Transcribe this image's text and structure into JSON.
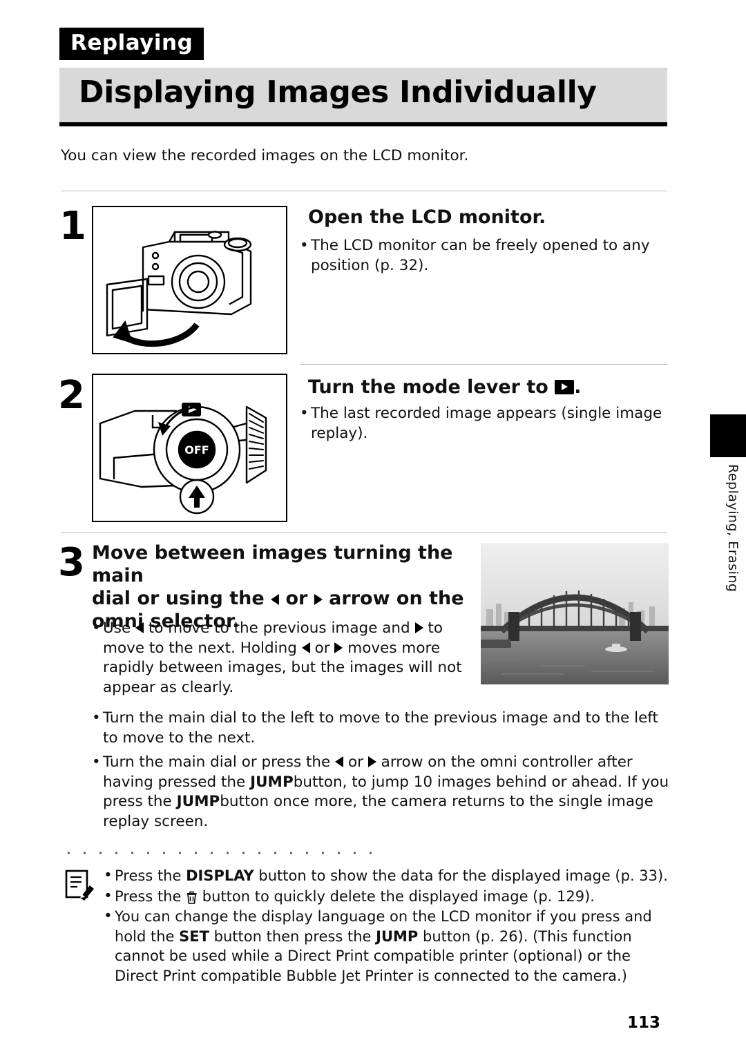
{
  "header": {
    "section_tag": "Replaying",
    "title": "Displaying Images Individually"
  },
  "intro": "You can view the recorded images on the LCD monitor.",
  "steps": [
    {
      "number": "1",
      "heading": "Open the LCD monitor.",
      "bullets": [
        "The LCD monitor can be freely opened to any position (p. 32)."
      ],
      "illustration": "camera-lcd-monitor-open-diagram"
    },
    {
      "number": "2",
      "heading_prefix": "Turn the mode lever to",
      "heading_suffix": ".",
      "heading_icon": "replay-mode-icon",
      "bullets": [
        "The last recorded image appears (single image replay)."
      ],
      "illustration": "camera-mode-dial-diagram"
    },
    {
      "number": "3",
      "heading_part1": "Move between images turning the main",
      "heading_part2_a": "dial or using the",
      "heading_part2_b": "or",
      "heading_part2_c": "arrow on the",
      "heading_part3": "omni selector.",
      "bullets": [
        {
          "a": "Use",
          "b": "to move to the previous image and",
          "c": "to move to the next. Holding",
          "d": "or",
          "e": "moves more rapidly between images, but the images will not appear as clearly."
        },
        {
          "text": "Turn the main dial to the left to move to the previous image and to the left to move to the next."
        },
        {
          "a": "Turn the main dial or press the",
          "b": "or",
          "c": "arrow on the omni controller after having pressed the",
          "jump1": "JUMP",
          "d": "button, to jump 10 images behind or ahead. If you press the",
          "jump2": "JUMP",
          "e": "button once more, the camera returns to the single image replay screen."
        }
      ],
      "photo_caption": "sydney-harbour-bridge-sample-photo"
    }
  ],
  "notes": [
    {
      "a": "Press the",
      "kbd": "DISPLAY",
      "b": "button to show the data for the displayed image (p. 33)."
    },
    {
      "a": "Press the",
      "icon": "trash-icon",
      "b": "button to quickly delete the displayed image (p. 129)."
    },
    {
      "a": "You can change the display language on the LCD monitor if you press and hold the",
      "kbd1": "SET",
      "b": "button then press the",
      "kbd2": "JUMP",
      "c": "button (p. 26). (This function cannot be used while a Direct Print compatible printer (optional) or the Direct Print compatible Bubble Jet Printer is connected to the camera.)"
    }
  ],
  "side_tab_text": "Replaying, Erasing",
  "page_number": "113",
  "colors": {
    "title_bar_bg": "#d9d9d9",
    "tag_bg": "#000000",
    "rule": "#b9b9b9"
  }
}
